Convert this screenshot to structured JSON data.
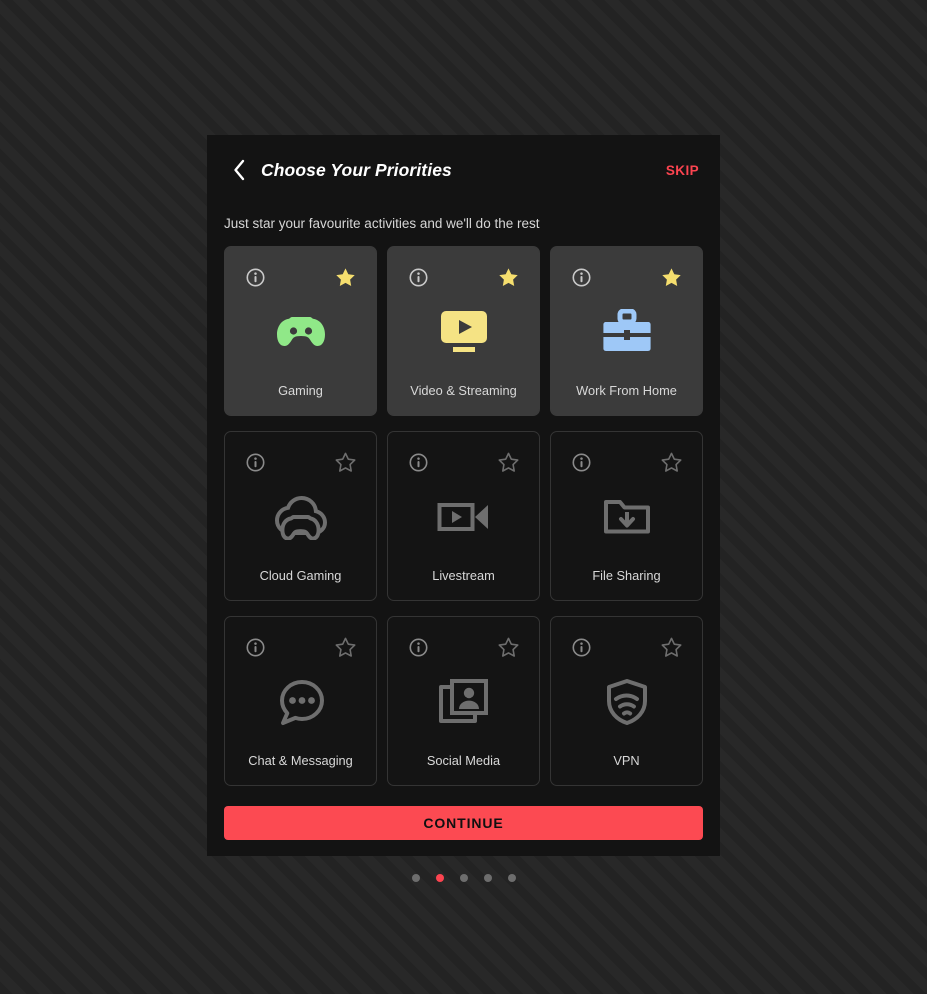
{
  "header": {
    "back_icon": "chevron-left-icon",
    "title": "Choose Your Priorities",
    "skip_label": "SKIP"
  },
  "subtitle": "Just star your favourite activities and we'll do the rest",
  "cards": [
    {
      "id": "gaming",
      "label": "Gaming",
      "icon": "gamepad-icon",
      "selected": true,
      "color": "#90e888",
      "info_icon": "info-icon",
      "star_icon": "star-filled-icon"
    },
    {
      "id": "video",
      "label": "Video & Streaming",
      "icon": "monitor-play-icon",
      "selected": true,
      "color": "#f5e384",
      "info_icon": "info-icon",
      "star_icon": "star-filled-icon"
    },
    {
      "id": "work-from-home",
      "label": "Work From Home",
      "icon": "briefcase-icon",
      "selected": true,
      "color": "#9ec8f7",
      "info_icon": "info-icon",
      "star_icon": "star-filled-icon"
    },
    {
      "id": "cloud-gaming",
      "label": "Cloud Gaming",
      "icon": "cloud-gamepad-icon",
      "selected": false,
      "color": "#6e6e6e",
      "info_icon": "info-icon",
      "star_icon": "star-outline-icon"
    },
    {
      "id": "livestream",
      "label": "Livestream",
      "icon": "video-camera-icon",
      "selected": false,
      "color": "#6e6e6e",
      "info_icon": "info-icon",
      "star_icon": "star-outline-icon"
    },
    {
      "id": "file-sharing",
      "label": "File Sharing",
      "icon": "folder-download-icon",
      "selected": false,
      "color": "#6e6e6e",
      "info_icon": "info-icon",
      "star_icon": "star-outline-icon"
    },
    {
      "id": "chat",
      "label": "Chat & Messaging",
      "icon": "chat-bubble-icon",
      "selected": false,
      "color": "#6e6e6e",
      "info_icon": "info-icon",
      "star_icon": "star-outline-icon"
    },
    {
      "id": "social-media",
      "label": "Social Media",
      "icon": "photos-person-icon",
      "selected": false,
      "color": "#6e6e6e",
      "info_icon": "info-icon",
      "star_icon": "star-outline-icon"
    },
    {
      "id": "vpn",
      "label": "VPN",
      "icon": "shield-wifi-icon",
      "selected": false,
      "color": "#6e6e6e",
      "info_icon": "info-icon",
      "star_icon": "star-outline-icon"
    }
  ],
  "continue_label": "CONTINUE",
  "pagination": {
    "total": 5,
    "active_index": 1
  },
  "colors": {
    "accent_red": "#fc4a52",
    "star_yellow": "#f5de6e",
    "panel_bg": "#131313",
    "card_selected_bg": "#3b3b3b",
    "card_bg": "#141414"
  }
}
